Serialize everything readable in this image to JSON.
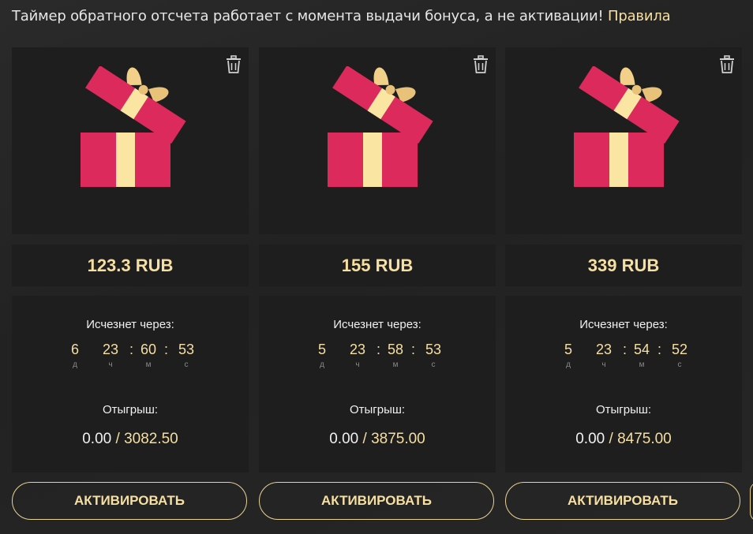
{
  "notice": {
    "text": "Таймер обратного отсчета работает с момента выдачи бонуса, а не активации!",
    "rules_link": "Правила"
  },
  "labels": {
    "expires": "Исчезнет через:",
    "wager": "Отыгрыш:",
    "activate": "АКТИВИРОВАТЬ",
    "unit_days": "д",
    "unit_hours": "ч",
    "unit_minutes": "м",
    "unit_seconds": "с",
    "sep": ":",
    "slash": "/"
  },
  "cards": [
    {
      "amount": "123.3 RUB",
      "timer": {
        "d": "6",
        "h": "23",
        "m": "60",
        "s": "53"
      },
      "wager_current": "0.00",
      "wager_total": "3082.50"
    },
    {
      "amount": "155 RUB",
      "timer": {
        "d": "5",
        "h": "23",
        "m": "58",
        "s": "53"
      },
      "wager_current": "0.00",
      "wager_total": "3875.00"
    },
    {
      "amount": "339 RUB",
      "timer": {
        "d": "5",
        "h": "23",
        "m": "54",
        "s": "52"
      },
      "wager_current": "0.00",
      "wager_total": "8475.00"
    }
  ],
  "icons": {
    "trash": "trash-icon",
    "gift": "gift-icon"
  },
  "colors": {
    "accent": "#f6dfa0",
    "gift_red": "#dc2a5c",
    "gift_ribbon": "#fae5a3",
    "panel": "#1e1e1e"
  }
}
